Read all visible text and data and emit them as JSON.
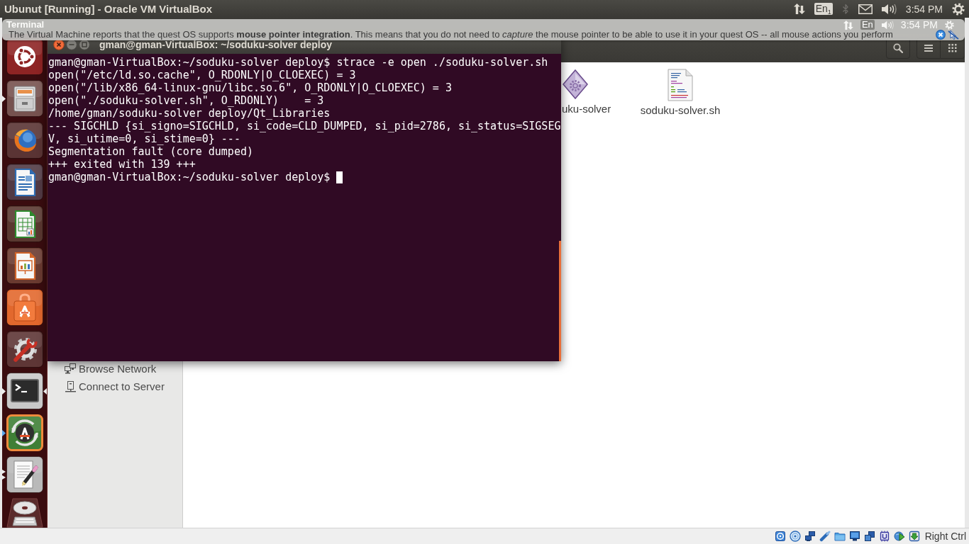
{
  "host_window": {
    "title": "Ubunut [Running] - Oracle VM VirtualBox",
    "indicators": [
      {
        "kind": "network",
        "disabled": false
      },
      {
        "kind": "keyboard",
        "label": "En$_{1}$",
        "disabled": false
      },
      {
        "kind": "bluetooth",
        "disabled": true
      },
      {
        "kind": "mail",
        "disabled": false
      },
      {
        "kind": "volume",
        "disabled": false
      },
      {
        "kind": "clock",
        "label": "3:54 PM",
        "disabled": false
      },
      {
        "kind": "session",
        "disabled": false
      }
    ]
  },
  "guest_panel": {
    "title": "Terminal",
    "indicators": [
      {
        "kind": "network"
      },
      {
        "kind": "keyboard",
        "label": "En"
      },
      {
        "kind": "volume"
      },
      {
        "kind": "clock",
        "label": "3:54 PM"
      },
      {
        "kind": "session"
      }
    ]
  },
  "notification": {
    "message": "The Virtual Machine reports that the quest OS supports **mouse pointer integration**. This means that you do not need to *capture* the mouse pointer to be able to use it in your quest OS -- all mouse actions you perform"
  },
  "launcher": [
    {
      "kind": "dash",
      "running": false,
      "focused": false,
      "urgent": false,
      "multiple_windows": false
    },
    {
      "kind": "files",
      "running": true,
      "focused": false,
      "urgent": false,
      "multiple_windows": false
    },
    {
      "kind": "firefox",
      "running": false,
      "focused": false,
      "urgent": false,
      "multiple_windows": false
    },
    {
      "kind": "writer",
      "running": false,
      "focused": false,
      "urgent": false,
      "multiple_windows": false
    },
    {
      "kind": "calc",
      "running": false,
      "focused": false,
      "urgent": false,
      "multiple_windows": false
    },
    {
      "kind": "impress",
      "running": false,
      "focused": false,
      "urgent": false,
      "multiple_windows": false
    },
    {
      "kind": "software",
      "running": false,
      "focused": false,
      "urgent": false,
      "multiple_windows": false
    },
    {
      "kind": "settings",
      "running": false,
      "focused": false,
      "urgent": false,
      "multiple_windows": false
    },
    {
      "kind": "terminal",
      "running": true,
      "focused": true,
      "urgent": false,
      "multiple_windows": false
    },
    {
      "kind": "updater",
      "running": true,
      "focused": false,
      "urgent": true,
      "multiple_windows": false
    },
    {
      "kind": "editor",
      "running": true,
      "focused": false,
      "urgent": false,
      "multiple_windows": true
    },
    {
      "kind": "drive",
      "running": false,
      "focused": false,
      "urgent": false,
      "multiple_windows": false
    }
  ],
  "terminal": {
    "title": "gman@gman-VirtualBox: ~/soduku-solver deploy",
    "lines": [
      "gman@gman-VirtualBox:~/soduku-solver deploy$ strace -e open ./soduku-solver.sh",
      "open(\"/etc/ld.so.cache\", O_RDONLY|O_CLOEXEC) = 3",
      "open(\"/lib/x86_64-linux-gnu/libc.so.6\", O_RDONLY|O_CLOEXEC) = 3",
      "open(\"./soduku-solver.sh\", O_RDONLY)    = 3",
      "/home/gman/soduku-solver deploy/Qt_Libraries",
      "--- SIGCHLD {si_signo=SIGCHLD, si_code=CLD_DUMPED, si_pid=2786, si_status=SIGSEG",
      "V, si_utime=0, si_stime=0} ---",
      "Segmentation fault (core dumped)",
      "+++ exited with 139 +++",
      "gman@gman-VirtualBox:~/soduku-solver deploy$"
    ],
    "cursor": true
  },
  "file_manager": {
    "sidebar": {
      "items": [
        {
          "kind": "network",
          "label": "Browse Network"
        },
        {
          "kind": "server",
          "label": "Connect to Server"
        }
      ]
    },
    "files": [
      {
        "kind": "executable",
        "name": "uku-solver"
      },
      {
        "kind": "script",
        "name": "soduku-solver.sh"
      }
    ]
  },
  "status_bar": {
    "host_key": "Right Ctrl"
  }
}
